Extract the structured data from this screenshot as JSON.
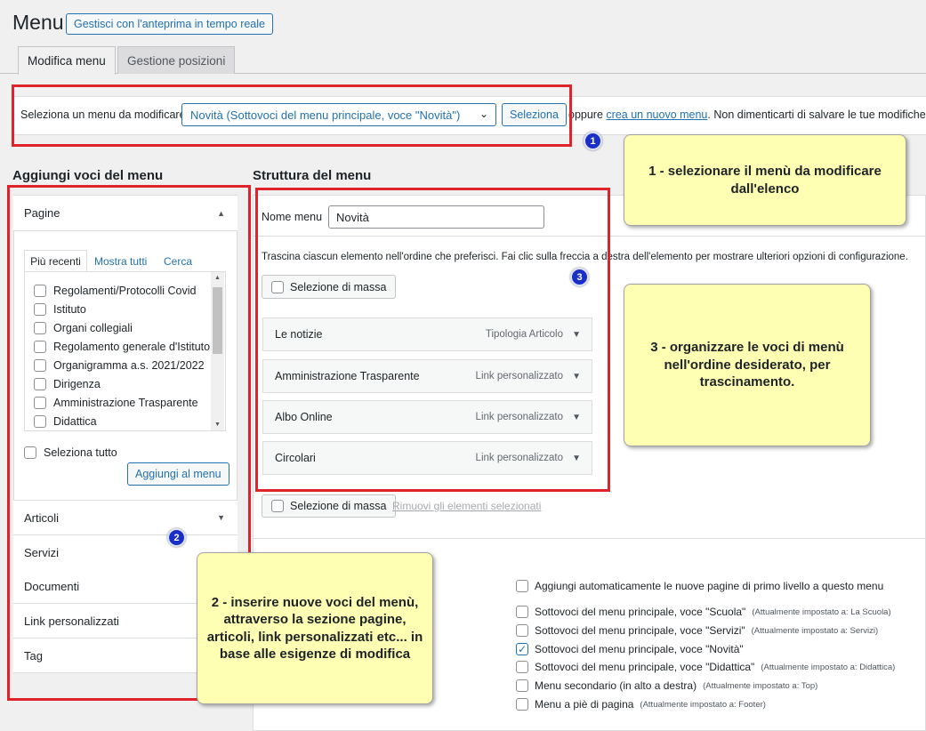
{
  "page": {
    "title": "Menu",
    "live_preview_button": "Gestisci con l'anteprima in tempo reale"
  },
  "tabs": [
    {
      "label": "Modifica menu",
      "active": true
    },
    {
      "label": "Gestione posizioni",
      "active": false
    }
  ],
  "select_bar": {
    "label": "Seleziona un menu da modificare:",
    "selected": "Novità (Sottovoci del menu principale, voce \"Novità\")",
    "select_button": "Seleziona",
    "or_text": "oppure",
    "create_link": "crea un nuovo menu",
    "reminder": ". Non dimenticarti di salvare le tue modifiche!"
  },
  "add_items": {
    "heading": "Aggiungi voci del menu",
    "pages_section": "Pagine",
    "subtabs": [
      "Più recenti",
      "Mostra tutti",
      "Cerca"
    ],
    "pages": [
      "Regolamenti/Protocolli Covid",
      "Istituto",
      "Organi collegiali",
      "Regolamento generale d'Istituto",
      "Organigramma a.s. 2021/2022",
      "Dirigenza",
      "Amministrazione Trasparente",
      "Didattica"
    ],
    "select_all": "Seleziona tutto",
    "add_button": "Aggiungi al menu",
    "sections": [
      "Articoli",
      "Servizi",
      "Documenti",
      "Link personalizzati",
      "Tag"
    ]
  },
  "structure": {
    "heading": "Struttura del menu",
    "name_label": "Nome menu",
    "name_value": "Novità",
    "instructions": "Trascina ciascun elemento nell'ordine che preferisci. Fai clic sulla freccia a destra dell'elemento per mostrare ulteriori opzioni di configurazione.",
    "bulk_select": "Selezione di massa",
    "remove_selected": "Rimuovi gli elementi selezionati",
    "items": [
      {
        "title": "Le notizie",
        "type": "Tipologia Articolo"
      },
      {
        "title": "Amministrazione Trasparente",
        "type": "Link personalizzato"
      },
      {
        "title": "Albo Online",
        "type": "Link personalizzato"
      },
      {
        "title": "Circolari",
        "type": "Link personalizzato"
      }
    ]
  },
  "settings": {
    "auto_add": "Aggiungi automaticamente le nuove pagine di primo livello a questo menu",
    "locations": [
      {
        "label": "Sottovoci del menu principale, voce \"Scuola\"",
        "note": "(Attualmente impostato a: La Scuola)",
        "checked": false
      },
      {
        "label": "Sottovoci del menu principale, voce \"Servizi\"",
        "note": "(Attualmente impostato a: Servizi)",
        "checked": false
      },
      {
        "label": "Sottovoci del menu principale, voce \"Novità\"",
        "note": "",
        "checked": true
      },
      {
        "label": "Sottovoci del menu principale, voce \"Didattica\"",
        "note": "(Attualmente impostato a: Didattica)",
        "checked": false
      },
      {
        "label": "Menu secondario (in alto a destra)",
        "note": "(Attualmente impostato a: Top)",
        "checked": false
      },
      {
        "label": "Menu a piè di pagina",
        "note": "(Attualmente impostato a: Footer)",
        "checked": false
      }
    ]
  },
  "annotations": {
    "badges": [
      "1",
      "2",
      "3"
    ],
    "note1": "1 - selezionare il menù da modificare dall'elenco",
    "note2": "2 - inserire nuove voci del menù, attraverso la sezione pagine, articoli, link personalizzati etc... in base alle esigenze di modifica",
    "note3": "3 - organizzare le voci di menù nell'ordine desiderato, per trascinamento."
  },
  "colors": {
    "accent": "#2271b1",
    "highlight_border": "#e0222b",
    "note_bg": "#ffffb3",
    "badge": "#1a2fc7"
  }
}
